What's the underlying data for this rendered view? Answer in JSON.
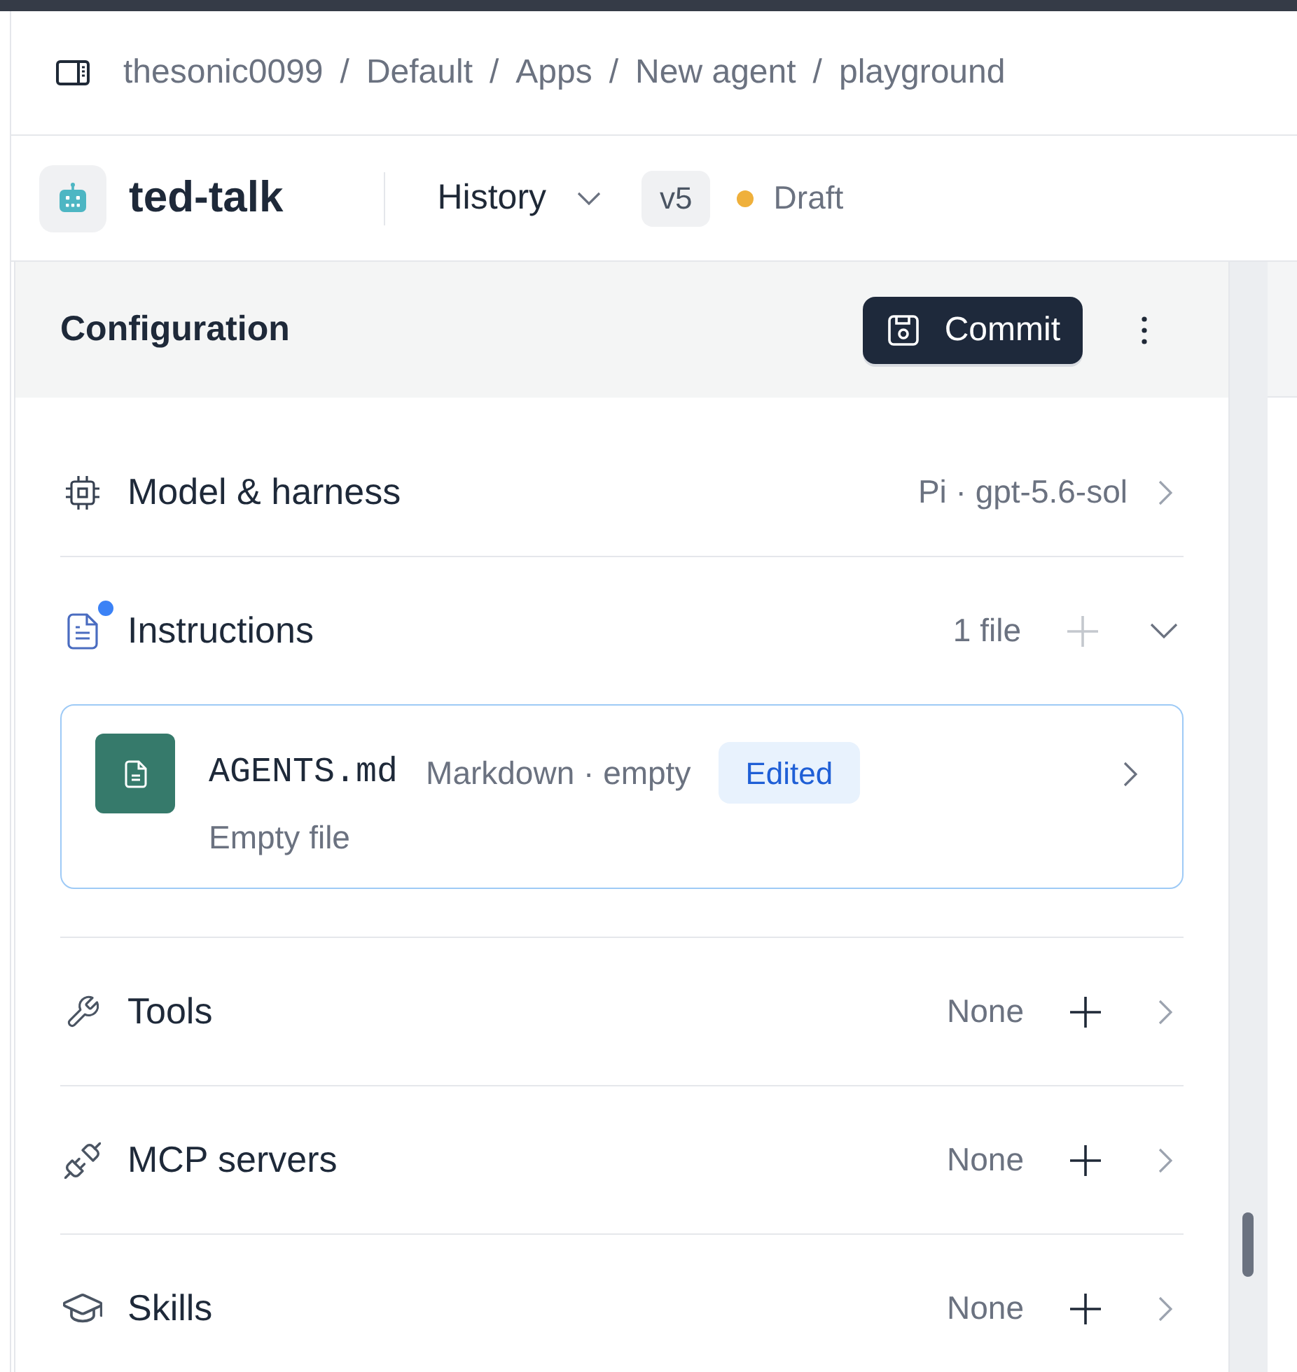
{
  "breadcrumb": {
    "items": [
      {
        "label": "thesonic0099",
        "separator": "/"
      },
      {
        "label": "Default",
        "separator": "/"
      },
      {
        "label": "Apps",
        "separator": "/"
      },
      {
        "label": "New agent",
        "separator": "/"
      },
      {
        "label": "playground"
      }
    ]
  },
  "agent": {
    "name": "ted-talk",
    "history_label": "History",
    "version": "v5",
    "status": {
      "label": "Draft",
      "draft": true
    }
  },
  "configuration": {
    "title": "Configuration",
    "commit_label": "Commit",
    "sections": [
      {
        "kind": "model",
        "label": "Model & harness",
        "value": "Pi · gpt-5.6-sol",
        "expanded": false,
        "modified": false
      },
      {
        "kind": "instructions",
        "label": "Instructions",
        "value": "1 file",
        "expanded": true,
        "modified": true,
        "add_button": {
          "disabled": true
        },
        "files": [
          {
            "name": "AGENTS.md",
            "meta": "Markdown · empty",
            "badge": "Edited",
            "description": "Empty file",
            "selected": true
          }
        ]
      },
      {
        "kind": "tools",
        "label": "Tools",
        "value": "None",
        "expanded": false,
        "modified": false,
        "add_button": {
          "disabled": false
        }
      },
      {
        "kind": "mcp",
        "label": "MCP servers",
        "value": "None",
        "expanded": false,
        "modified": false,
        "add_button": {
          "disabled": false
        }
      },
      {
        "kind": "skills",
        "label": "Skills",
        "value": "None",
        "expanded": false,
        "modified": false,
        "add_button": {
          "disabled": false
        }
      }
    ]
  }
}
